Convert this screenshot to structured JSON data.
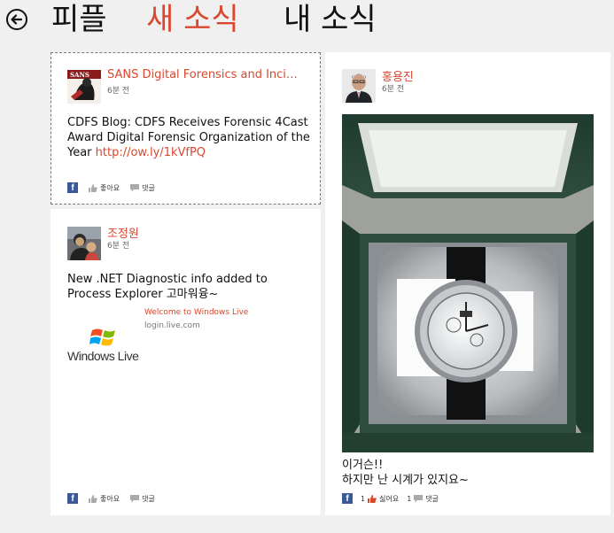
{
  "nav": {
    "tabs": [
      {
        "label": "피플"
      },
      {
        "label": "새 소식"
      },
      {
        "label": "내 소식"
      }
    ]
  },
  "colors": {
    "accent": "#d9482e",
    "facebook": "#3b5998",
    "background": "#f0f0f0"
  },
  "icons": {
    "back": "back-arrow-icon",
    "facebook": "facebook-icon",
    "like": "thumbs-up-icon",
    "comment": "comment-icon"
  },
  "posts": [
    {
      "author": "SANS Digital Forensics and Incid...",
      "time": "6분 전",
      "text": "CDFS Blog: CDFS Receives Forensic 4Cast Award Digital Forensic Organization of the Year ",
      "link": "http://ow.ly/1kVfPQ",
      "footer": {
        "source": "f",
        "like": "좋아요",
        "comment": "댓글"
      }
    },
    {
      "author": "조정원",
      "time": "6분 전",
      "text": "New .NET Diagnostic info added to Process Explorer 고마워융~",
      "link_preview": {
        "title": "Welcome to Windows Live",
        "domain": "login.live.com",
        "logo_text": "Windows Live"
      },
      "footer": {
        "source": "f",
        "like": "좋아요",
        "comment": "댓글"
      }
    },
    {
      "author": "홍용진",
      "time": "6분 전",
      "text_line1": "이거슨!!",
      "text_line2": "하지만 난 시계가 있지요~",
      "footer": {
        "source": "f",
        "like_count": "1",
        "like": "싫어요",
        "comment_count": "1",
        "comment": "댓글"
      }
    }
  ]
}
